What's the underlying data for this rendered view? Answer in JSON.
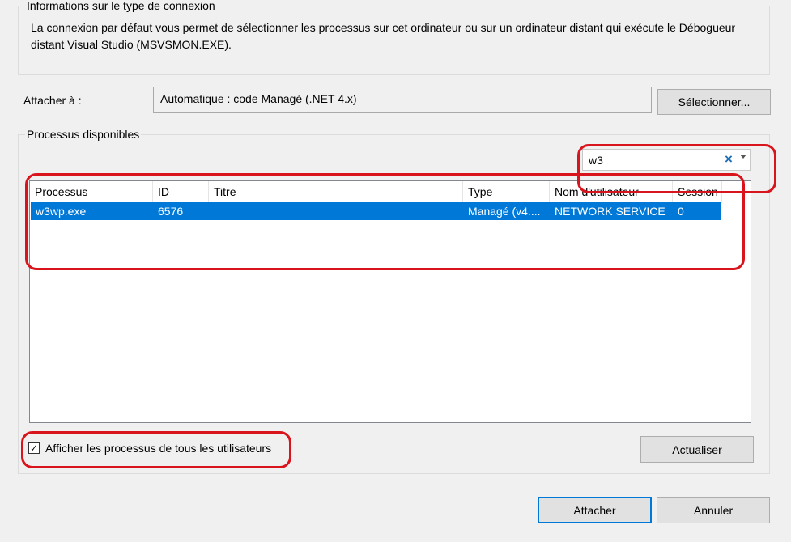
{
  "connection": {
    "legend": "Informations sur le type de connexion",
    "description": "La connexion par défaut vous permet de sélectionner les processus sur cet ordinateur ou sur un ordinateur distant qui exécute le Débogueur distant Visual Studio (MSVSMON.EXE)."
  },
  "attach": {
    "label": "Attacher à :",
    "value": "Automatique : code Managé (.NET 4.x)",
    "select_label": "Sélectionner..."
  },
  "processes": {
    "legend": "Processus disponibles",
    "search_value": "w3",
    "search_clear_glyph": "×",
    "columns": [
      "Processus",
      "ID",
      "Titre",
      "Type",
      "Nom d'utilisateur",
      "Session"
    ],
    "rows": [
      {
        "process": "w3wp.exe",
        "id": "6576",
        "title": "",
        "type": "Managé (v4....",
        "user": "NETWORK SERVICE",
        "session": "0",
        "selected": true
      }
    ],
    "show_all_label": "Afficher les processus de tous les utilisateurs",
    "show_all_checked": true,
    "checkmark": "✓",
    "refresh_label": "Actualiser"
  },
  "footer": {
    "attach_label": "Attacher",
    "cancel_label": "Annuler"
  },
  "colors": {
    "selection": "#0078d7",
    "annotation": "#d9141d"
  }
}
